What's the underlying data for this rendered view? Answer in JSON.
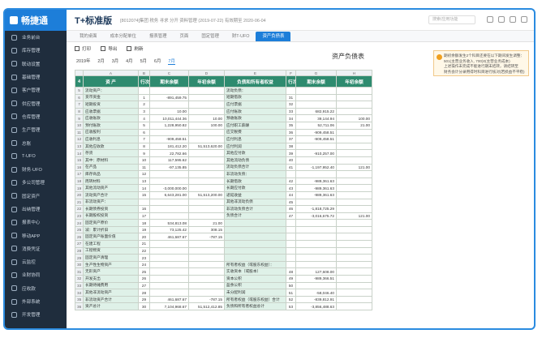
{
  "sidebar": {
    "brand": "畅捷通",
    "items": [
      "业务前台",
      "库存管理",
      "联动设置",
      "基础管理",
      "客户管理",
      "供应管理",
      "仓库管理",
      "生产管理",
      "总账",
      "T-UFO",
      "财务·UFO",
      "多公司管理",
      "固定资产",
      "出纳管理",
      "报表中心",
      "移动APP",
      "消费凭证",
      "云监控",
      "业财协同",
      "应收款",
      "外部系统",
      "开发管理"
    ]
  },
  "header": {
    "brand": "T+标准版",
    "info": "[8012074]集团 税务 寻求 分开 资料管理 (2019-07-22) 有效期至 2020-06-04",
    "search_placeholder": "搜索/应用功能"
  },
  "tabs": [
    "我的桌面",
    "成本分配单位",
    "报表管理",
    "页面",
    "固定管理",
    "财T-UFO",
    "资产负债表"
  ],
  "toolbar": {
    "print": "打印",
    "export": "导出",
    "refresh": "刷新"
  },
  "period": {
    "year": "2019年",
    "months": [
      "2月",
      "3月",
      "4月",
      "5月",
      "6月",
      "7月"
    ]
  },
  "report_title": "资产负债表",
  "notice": {
    "line1": "期初余额发生2个科目还要在以下期间发生调整：501(主营业务收入, 700)0(主营业务成本)",
    "line1_red": "501主营业务收入，700101主营业务成本",
    "line2": "上述操作未完成不能进行期末结转，请结转至",
    "line3": "财务会计分录用得时科目进行核对(若损益不平稳)"
  },
  "sheet": {
    "columns": [
      "A",
      "B",
      "C",
      "D",
      "E",
      "F",
      "G",
      "H"
    ],
    "header": [
      "资  产",
      "行次",
      "期末余额",
      "年初余额",
      "负债和所有者权益",
      "行次",
      "期末余额",
      "年初余额"
    ],
    "rows": [
      {
        "n": "5",
        "a": "流动资产：",
        "b": "",
        "c": "",
        "d": "",
        "e": "流动负债：",
        "f": "",
        "g": "",
        "h": ""
      },
      {
        "n": "6",
        "a": "货币资金",
        "b": "1",
        "c": "-891,459.75",
        "d": "",
        "e": "短期借款",
        "f": "31",
        "g": "",
        "h": ""
      },
      {
        "n": "7",
        "a": "短期投资",
        "b": "2",
        "c": "",
        "d": "",
        "e": "应付票据",
        "f": "32",
        "g": "",
        "h": ""
      },
      {
        "n": "8",
        "a": "应收票据",
        "b": "3",
        "c": "10.00",
        "d": "",
        "e": "应付账款",
        "f": "33",
        "g": "682,915.22",
        "h": ""
      },
      {
        "n": "9",
        "a": "应收账款",
        "b": "4",
        "c": "10,011,444.36",
        "d": "10.00",
        "e": "预收账款",
        "f": "34",
        "g": "39,144.94",
        "h": "100.00"
      },
      {
        "n": "10",
        "a": "预付账款",
        "b": "5",
        "c": "1,228,950.82",
        "d": "100.00",
        "e": "应付职工薪酬",
        "f": "35",
        "g": "52,711.06",
        "h": "21.00"
      },
      {
        "n": "11",
        "a": "应收股利",
        "b": "6",
        "c": "",
        "d": "",
        "e": "应交税费",
        "f": "36",
        "g": "-909,458.51",
        "h": ""
      },
      {
        "n": "12",
        "a": "应收利息",
        "b": "7",
        "c": "-909,458.51",
        "d": "",
        "e": "应付利息",
        "f": "37",
        "g": "-909,458.51",
        "h": ""
      },
      {
        "n": "13",
        "a": "其他应收款",
        "b": "8",
        "c": "181,412.20",
        "d": "51,513,620.00",
        "e": "应付利润",
        "f": "38",
        "g": "",
        "h": ""
      },
      {
        "n": "14",
        "a": "存货",
        "b": "9",
        "c": "22,782.66",
        "d": "",
        "e": "其他应付款",
        "f": "39",
        "g": "-910,257.00",
        "h": ""
      },
      {
        "n": "15",
        "a": "其中：原材料",
        "b": "10",
        "c": "117,595.62",
        "d": "",
        "e": "其他流动负债",
        "f": "40",
        "g": "",
        "h": ""
      },
      {
        "n": "16",
        "a": "在产品",
        "b": "11",
        "c": "-97,135.85",
        "d": "",
        "e": "流动负债合计",
        "f": "41",
        "g": "-1,197,952.40",
        "h": "121.00"
      },
      {
        "n": "17",
        "a": "库存商品",
        "b": "12",
        "c": "",
        "d": "",
        "e": "非流动负债：",
        "f": "",
        "g": "",
        "h": ""
      },
      {
        "n": "18",
        "a": "周转材料",
        "b": "13",
        "c": "",
        "d": "",
        "e": "长期借款",
        "f": "42",
        "g": "-989,361.63",
        "h": ""
      },
      {
        "n": "19",
        "a": "其他流动资产",
        "b": "14",
        "c": "-3,000,000.00",
        "d": "",
        "e": "长期应付款",
        "f": "43",
        "g": "-989,361.63",
        "h": ""
      },
      {
        "n": "20",
        "a": "流动资产合计",
        "b": "15",
        "c": "6,643,281.00",
        "d": "51,513,200.00",
        "e": "递延收益",
        "f": "44",
        "g": "-989,361.63",
        "h": ""
      },
      {
        "n": "21",
        "a": "非流动资产：",
        "b": "",
        "c": "",
        "d": "",
        "e": "其他非流动负债",
        "f": "45",
        "g": "",
        "h": ""
      },
      {
        "n": "22",
        "a": "长期债券投资",
        "b": "16",
        "c": "",
        "d": "",
        "e": "非流动负债合计",
        "f": "46",
        "g": "-1,818,725.29",
        "h": ""
      },
      {
        "n": "23",
        "a": "长期股权投资",
        "b": "17",
        "c": "",
        "d": "",
        "e": "负债合计",
        "f": "47",
        "g": "-3,016,675.72",
        "h": "121.00"
      },
      {
        "n": "24",
        "a": "固定资产原价",
        "b": "18",
        "c": "534,813.08",
        "d": "21.00",
        "e": "",
        "f": "",
        "g": "",
        "h": ""
      },
      {
        "n": "25",
        "a": "减：累计折旧",
        "b": "19",
        "c": "73,125.42",
        "d": "308.15",
        "e": "",
        "f": "",
        "g": "",
        "h": ""
      },
      {
        "n": "26",
        "a": "固定资产账面价值",
        "b": "20",
        "c": "461,687.67",
        "d": "-787.15",
        "e": "",
        "f": "",
        "g": "",
        "h": ""
      },
      {
        "n": "27",
        "a": "在建工程",
        "b": "21",
        "c": "",
        "d": "",
        "e": "",
        "f": "",
        "g": "",
        "h": ""
      },
      {
        "n": "28",
        "a": "工程物资",
        "b": "22",
        "c": "",
        "d": "",
        "e": "",
        "f": "",
        "g": "",
        "h": ""
      },
      {
        "n": "29",
        "a": "固定资产清理",
        "b": "23",
        "c": "",
        "d": "",
        "e": "",
        "f": "",
        "g": "",
        "h": ""
      },
      {
        "n": "30",
        "a": "生产性生物资产",
        "b": "24",
        "c": "",
        "d": "",
        "e": "所有者权益（或股东权益）：",
        "f": "",
        "g": "",
        "h": ""
      },
      {
        "n": "31",
        "a": "无形资产",
        "b": "25",
        "c": "",
        "d": "",
        "e": "实收资本（或股本）",
        "f": "48",
        "g": "127,608.00",
        "h": ""
      },
      {
        "n": "32",
        "a": "开发支出",
        "b": "26",
        "c": "",
        "d": "",
        "e": "资本公积",
        "f": "49",
        "g": "-989,366.51",
        "h": ""
      },
      {
        "n": "33",
        "a": "长期待摊费用",
        "b": "27",
        "c": "",
        "d": "",
        "e": "盈余公积",
        "f": "50",
        "g": "",
        "h": ""
      },
      {
        "n": "34",
        "a": "其他非流动资产",
        "b": "28",
        "c": "",
        "d": "",
        "e": "未分配利润",
        "f": "51",
        "g": "-58,046.40",
        "h": ""
      },
      {
        "n": "35",
        "a": "非流动资产合计",
        "b": "29",
        "c": "461,687.67",
        "d": "-787.15",
        "e": "所有者权益（或股东权益）合计",
        "f": "52",
        "g": "-839,812.91",
        "h": ""
      },
      {
        "n": "36",
        "a": "资产总计",
        "b": "30",
        "c": "7,104,968.67",
        "d": "51,512,412.85",
        "e": "负债和所有者权益总计",
        "f": "53",
        "g": "-3,856,488.63",
        "h": ""
      }
    ]
  }
}
